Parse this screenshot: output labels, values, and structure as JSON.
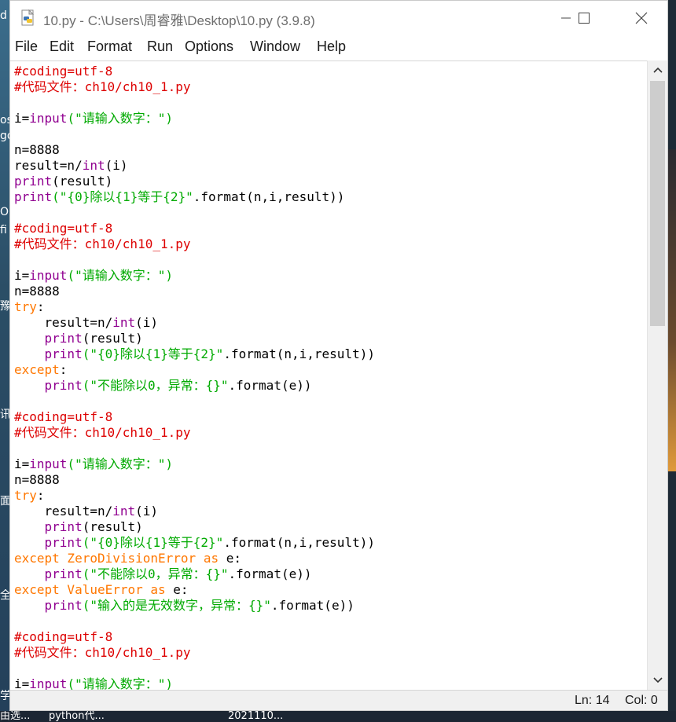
{
  "window": {
    "title": "10.py - C:\\Users\\周睿雅\\Desktop\\10.py (3.9.8)"
  },
  "menu": [
    "File",
    "Edit",
    "Format",
    "Run",
    "Options",
    "Window",
    "Help"
  ],
  "status": {
    "line": "Ln: 14",
    "col": "Col: 0"
  },
  "desktop": {
    "left_glyphs": [
      "d",
      "os",
      "go",
      "O",
      "fi",
      "豫",
      "讯",
      "面",
      "全",
      "学"
    ],
    "taskbar_items": [
      "由选...",
      "python代...",
      "2021110..."
    ]
  },
  "colors": {
    "comment": "#dd0000",
    "builtin": "#900090",
    "string": "#00aa00",
    "keyword": "#ff7700"
  },
  "code_lines": [
    [
      {
        "t": "#coding=utf-8",
        "c": "comment"
      }
    ],
    [
      {
        "t": "#代码文件：ch10/ch10_1.py",
        "c": "comment"
      }
    ],
    [],
    [
      {
        "t": "i="
      },
      {
        "t": "input",
        "c": "builtin"
      },
      {
        "t": "(\"请输入数字：\")",
        "c": "string"
      }
    ],
    [],
    [
      {
        "t": "n=8888"
      }
    ],
    [
      {
        "t": "result=n/"
      },
      {
        "t": "int",
        "c": "builtin"
      },
      {
        "t": "(i)"
      }
    ],
    [
      {
        "t": "print",
        "c": "builtin"
      },
      {
        "t": "(result)"
      }
    ],
    [
      {
        "t": "print",
        "c": "builtin"
      },
      {
        "t": "(\"{0}除以{1}等于{2}\"",
        "c": "string"
      },
      {
        "t": ".format(n,i,result))"
      }
    ],
    [],
    [
      {
        "t": "#coding=utf-8",
        "c": "comment"
      }
    ],
    [
      {
        "t": "#代码文件：ch10/ch10_1.py",
        "c": "comment"
      }
    ],
    [],
    [
      {
        "t": "i="
      },
      {
        "t": "input",
        "c": "builtin"
      },
      {
        "t": "(\"请输入数字：\")",
        "c": "string"
      }
    ],
    [
      {
        "t": "n=8888"
      }
    ],
    [
      {
        "t": "try",
        "c": "keyword"
      },
      {
        "t": ":"
      }
    ],
    [
      {
        "t": "    result=n/"
      },
      {
        "t": "int",
        "c": "builtin"
      },
      {
        "t": "(i)"
      }
    ],
    [
      {
        "t": "    "
      },
      {
        "t": "print",
        "c": "builtin"
      },
      {
        "t": "(result)"
      }
    ],
    [
      {
        "t": "    "
      },
      {
        "t": "print",
        "c": "builtin"
      },
      {
        "t": "(\"{0}除以{1}等于{2}\"",
        "c": "string"
      },
      {
        "t": ".format(n,i,result))"
      }
    ],
    [
      {
        "t": "except",
        "c": "keyword"
      },
      {
        "t": ":"
      }
    ],
    [
      {
        "t": "    "
      },
      {
        "t": "print",
        "c": "builtin"
      },
      {
        "t": "(\"不能除以0，异常：{}\"",
        "c": "string"
      },
      {
        "t": ".format(e))"
      }
    ],
    [],
    [
      {
        "t": "#coding=utf-8",
        "c": "comment"
      }
    ],
    [
      {
        "t": "#代码文件：ch10/ch10_1.py",
        "c": "comment"
      }
    ],
    [],
    [
      {
        "t": "i="
      },
      {
        "t": "input",
        "c": "builtin"
      },
      {
        "t": "(\"请输入数字：\")",
        "c": "string"
      }
    ],
    [
      {
        "t": "n=8888"
      }
    ],
    [
      {
        "t": "try",
        "c": "keyword"
      },
      {
        "t": ":"
      }
    ],
    [
      {
        "t": "    result=n/"
      },
      {
        "t": "int",
        "c": "builtin"
      },
      {
        "t": "(i)"
      }
    ],
    [
      {
        "t": "    "
      },
      {
        "t": "print",
        "c": "builtin"
      },
      {
        "t": "(result)"
      }
    ],
    [
      {
        "t": "    "
      },
      {
        "t": "print",
        "c": "builtin"
      },
      {
        "t": "(\"{0}除以{1}等于{2}\"",
        "c": "string"
      },
      {
        "t": ".format(n,i,result))"
      }
    ],
    [
      {
        "t": "except ZeroDivisionError as",
        "c": "keyword"
      },
      {
        "t": " e:"
      }
    ],
    [
      {
        "t": "    "
      },
      {
        "t": "print",
        "c": "builtin"
      },
      {
        "t": "(\"不能除以0，异常：{}\"",
        "c": "string"
      },
      {
        "t": ".format(e))"
      }
    ],
    [
      {
        "t": "except ValueError as",
        "c": "keyword"
      },
      {
        "t": " e:"
      }
    ],
    [
      {
        "t": "    "
      },
      {
        "t": "print",
        "c": "builtin"
      },
      {
        "t": "(\"输入的是无效数字，异常：{}\"",
        "c": "string"
      },
      {
        "t": ".format(e))"
      }
    ],
    [],
    [
      {
        "t": "#coding=utf-8",
        "c": "comment"
      }
    ],
    [
      {
        "t": "#代码文件：ch10/ch10_1.py",
        "c": "comment"
      }
    ],
    [],
    [
      {
        "t": "i="
      },
      {
        "t": "input",
        "c": "builtin"
      },
      {
        "t": "(\"请输入数字：\")",
        "c": "string"
      }
    ]
  ]
}
